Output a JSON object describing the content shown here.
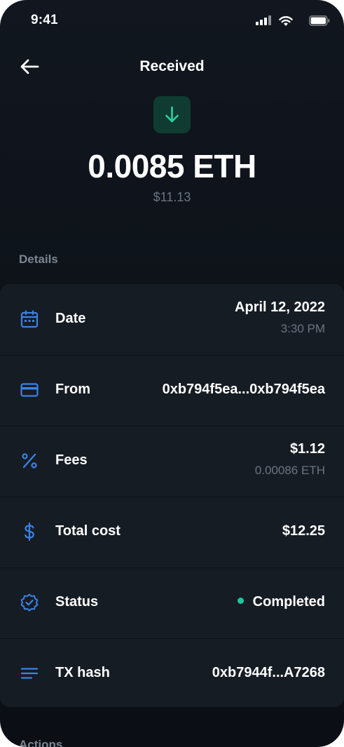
{
  "status_bar": {
    "time": "9:41"
  },
  "header": {
    "title": "Received"
  },
  "transaction": {
    "icon": "arrow-down-icon",
    "amount": "0.0085 ETH",
    "fiat": "$11.13"
  },
  "details": {
    "label": "Details",
    "rows": [
      {
        "icon": "calendar-icon",
        "label": "Date",
        "value": "April 12, 2022",
        "sub": "3:30 PM"
      },
      {
        "icon": "credit-card-icon",
        "label": "From",
        "value": "0xb794f5ea...0xb794f5ea"
      },
      {
        "icon": "percent-icon",
        "label": "Fees",
        "value": "$1.12",
        "sub": "0.00086 ETH"
      },
      {
        "icon": "dollar-icon",
        "label": "Total cost",
        "value": "$12.25"
      },
      {
        "icon": "verified-badge-icon",
        "label": "Status",
        "value": "Completed"
      },
      {
        "icon": "lines-icon",
        "label": "TX hash",
        "value": "0xb7944f...A7268"
      }
    ]
  },
  "actions": {
    "label": "Actions"
  },
  "colors": {
    "accent": "#3b82e6",
    "success": "#1ec79b",
    "background": "#0e131a",
    "card": "#161c24"
  }
}
